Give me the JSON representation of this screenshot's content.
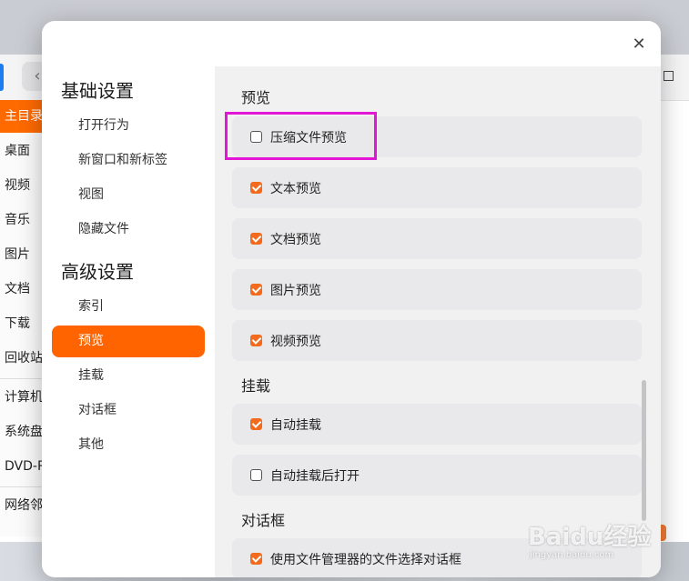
{
  "background": {
    "sidebar_items": [
      {
        "label": "主目录",
        "active": true
      },
      {
        "label": "桌面"
      },
      {
        "label": "视频"
      },
      {
        "label": "音乐"
      },
      {
        "label": "图片"
      },
      {
        "label": "文档"
      },
      {
        "label": "下载"
      },
      {
        "label": "回收站"
      },
      {
        "label": "计算机"
      },
      {
        "label": "系统盘"
      },
      {
        "label": "DVD-R"
      },
      {
        "label": "网络邻"
      }
    ],
    "back_icon": "chevron-left-icon",
    "accent": "#ff6a00"
  },
  "dialog": {
    "close_icon": "close-icon",
    "nav": {
      "basic_heading": "基础设置",
      "basic_items": [
        "打开行为",
        "新窗口和新标签",
        "视图",
        "隐藏文件"
      ],
      "advanced_heading": "高级设置",
      "advanced_items": [
        "索引",
        "预览",
        "挂载",
        "对话框",
        "其他"
      ],
      "active_item": "预览"
    },
    "sections": {
      "preview_title": "预览",
      "preview_options": [
        {
          "label": "压缩文件预览",
          "checked": false
        },
        {
          "label": "文本预览",
          "checked": true
        },
        {
          "label": "文档预览",
          "checked": true
        },
        {
          "label": "图片预览",
          "checked": true
        },
        {
          "label": "视频预览",
          "checked": true
        }
      ],
      "mount_title": "挂载",
      "mount_options": [
        {
          "label": "自动挂载",
          "checked": true
        },
        {
          "label": "自动挂载后打开",
          "checked": false
        }
      ],
      "dialog_title": "对话框",
      "dialog_options": [
        {
          "label": "使用文件管理器的文件选择对话框",
          "checked": true
        }
      ]
    },
    "checkbox_color": "#f26b1d",
    "highlight_color": "#e316d6"
  },
  "watermark": {
    "text": "Baidu经验",
    "sub": "jingyan.baidu.com"
  }
}
